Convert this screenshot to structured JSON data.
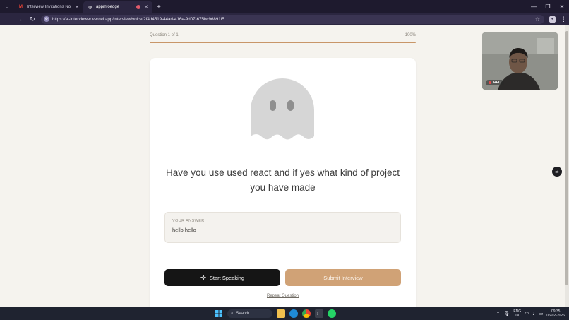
{
  "browser": {
    "tabs": [
      {
        "title": "Interview Invitations Noodle Lo...",
        "favicon": "gmail-icon",
        "active": false
      },
      {
        "title": "appinfoedge",
        "favicon": "globe-icon",
        "active": true
      }
    ],
    "url": "https://ai-interviewer.vercel.app/interview/voice/2f4d4519-44ad-416e-9d07-675bc96891f5"
  },
  "progress": {
    "label": "Question 1 of 1",
    "percent_label": "100%",
    "fraction": 1.0,
    "fill_color": "#c89668"
  },
  "question": {
    "text": "Have you use used react and if yes what kind of project you have made"
  },
  "answer": {
    "label": "YOUR ANSWER",
    "value": "hello hello"
  },
  "actions": {
    "start_speaking": "Start Speaking",
    "submit": "Submit Interview",
    "repeat": "Repeat Question"
  },
  "camera": {
    "rec_label": "REC"
  },
  "taskbar": {
    "search": "Search",
    "lang_top": "ENG",
    "lang_bottom": "IN",
    "time": "09:35",
    "date": "06-02-2026"
  },
  "colors": {
    "accent": "#d0a276",
    "primary_button": "#151515",
    "background": "#f5f3ee"
  }
}
